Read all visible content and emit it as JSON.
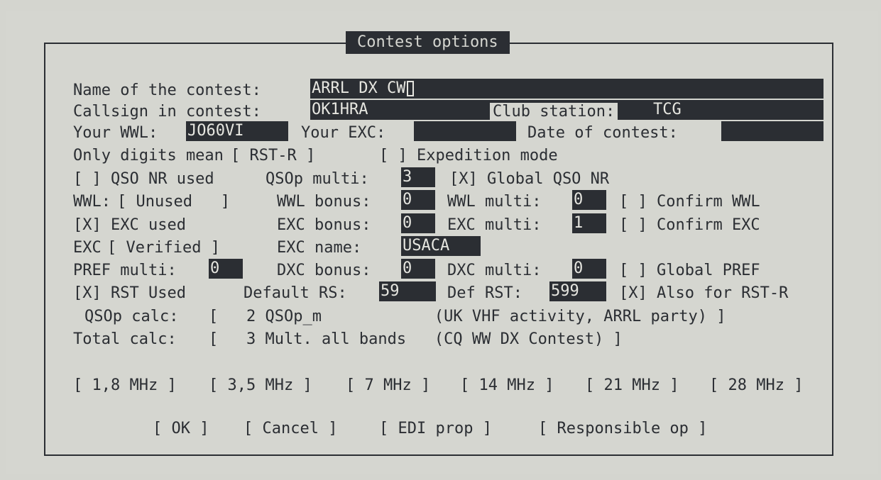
{
  "dialog": {
    "title": "Contest options"
  },
  "labels": {
    "name": "Name of the contest:",
    "callsign": "Callsign in contest:",
    "club": "Club station:",
    "wwl": "Your WWL:",
    "exc": "Your EXC:",
    "date": "Date of contest:",
    "only_digits": "Only digits mean",
    "qsop_multi": "QSOp multi:",
    "wwl_row": "WWL:",
    "wwl_bonus": "WWL bonus:",
    "wwl_multi": "WWL multi:",
    "exc_bonus": "EXC bonus:",
    "exc_multi": "EXC multi:",
    "exc_row": "EXC",
    "exc_name": "EXC name:",
    "pref_multi": "PREF multi:",
    "dxc_bonus": "DXC bonus:",
    "dxc_multi": "DXC multi:",
    "default_rs": "Default RS:",
    "def_rst": "Def RST:",
    "qsop_calc": "QSOp calc:",
    "total_calc": "Total calc:"
  },
  "fields": {
    "name": "ARRL DX CW",
    "callsign": "OK1HRA",
    "club": "TCG",
    "wwl": "JO60VI",
    "exc": "",
    "date": "",
    "qsop_multi": "3",
    "wwl_bonus": "0",
    "wwl_multi": "0",
    "exc_bonus": "0",
    "exc_multi": "1",
    "exc_name": "USACA",
    "pref_multi": "0",
    "dxc_bonus": "0",
    "dxc_multi": "0",
    "default_rs": "59",
    "def_rst": "599"
  },
  "selectors": {
    "only_digits": "[ RST-R ]",
    "wwl_mode": "[ Unused   ]",
    "exc_mode": "[ Verified ]",
    "qsop_calc": "[   2 QSOp_m            (UK VHF activity, ARRL party) ]",
    "total_calc": "[   3 Mult. all bands   (CQ WW DX Contest) ]"
  },
  "checkboxes": {
    "expedition": "[ ] Expedition mode",
    "qso_nr_used": "[ ] QSO NR used",
    "global_qso_nr": "[X] Global QSO NR",
    "confirm_wwl": "[ ] Confirm WWL",
    "exc_used": "[X] EXC used",
    "confirm_exc": "[ ] Confirm EXC",
    "global_pref": "[ ] Global PREF",
    "rst_used": "[X] RST Used",
    "also_rst_r": "[X] Also for RST-R"
  },
  "bands": [
    "[ 1,8 MHz ]",
    "[ 3,5 MHz ]",
    "[ 7 MHz ]",
    "[ 14 MHz ]",
    "[ 21 MHz ]",
    "[ 28 MHz ]"
  ],
  "buttons": {
    "ok": "[ OK ]",
    "cancel": "[ Cancel ]",
    "edi": "[ EDI prop ]",
    "responsible": "[ Responsible op ]"
  }
}
